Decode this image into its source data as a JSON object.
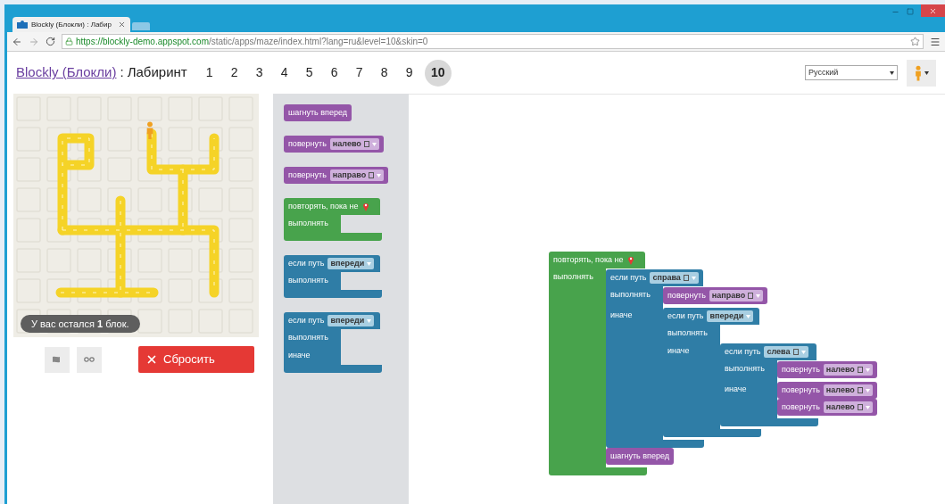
{
  "browser": {
    "tab_title": "Blockly (Блокли) : Лабир",
    "url_host": "https://blockly-demo.appspot.com",
    "url_path": "/static/apps/maze/index.html?lang=ru&level=10&skin=0"
  },
  "header": {
    "app_link": "Blockly (Блокли)",
    "separator": ":",
    "title": "Лабиринт",
    "levels": [
      {
        "label": "1",
        "selected": false
      },
      {
        "label": "2",
        "selected": false
      },
      {
        "label": "3",
        "selected": false
      },
      {
        "label": "4",
        "selected": false
      },
      {
        "label": "5",
        "selected": false
      },
      {
        "label": "6",
        "selected": false
      },
      {
        "label": "7",
        "selected": false
      },
      {
        "label": "8",
        "selected": false
      },
      {
        "label": "9",
        "selected": false
      },
      {
        "label": "10",
        "selected": true
      }
    ],
    "language": "Русский"
  },
  "maze": {
    "message": "У вас остался **1** блок.",
    "reset_button": "Сбросить"
  },
  "toolbox": [
    {
      "kind": "move",
      "label": "шагнуть вперед"
    },
    {
      "kind": "turn",
      "label": "повернуть",
      "option": {
        "text": "налево",
        "icon": true
      }
    },
    {
      "kind": "turn",
      "label": "повернуть",
      "option": {
        "text": "направо",
        "icon": true
      }
    },
    {
      "kind": "repeat",
      "label": "повторять, пока не",
      "do_label": "выполнять"
    },
    {
      "kind": "if",
      "label": "если путь",
      "option": {
        "text": "впереди",
        "icon": false
      },
      "do_label": "выполнять"
    },
    {
      "kind": "ifelse",
      "label": "если путь",
      "option": {
        "text": "впереди",
        "icon": false
      },
      "do_label": "выполнять",
      "else_label": "иначе"
    }
  ],
  "workspace": [
    {
      "kind": "repeat",
      "label": "повторять, пока не",
      "do_label": "выполнять",
      "body": [
        {
          "kind": "ifelse",
          "label": "если путь",
          "option": {
            "text": "справа",
            "icon": true
          },
          "do_label": "выполнять",
          "body": [
            {
              "kind": "turn",
              "label": "повернуть",
              "option": {
                "text": "направо",
                "icon": true
              }
            }
          ],
          "else_label": "иначе",
          "else_body": [
            {
              "kind": "ifelse",
              "label": "если путь",
              "option": {
                "text": "впереди",
                "icon": false
              },
              "do_label": "выполнять",
              "else_label": "иначе",
              "else_body": [
                {
                  "kind": "ifelse",
                  "label": "если путь",
                  "option": {
                    "text": "слева",
                    "icon": true
                  },
                  "do_label": "выполнять",
                  "body": [
                    {
                      "kind": "turn",
                      "label": "повернуть",
                      "option": {
                        "text": "налево",
                        "icon": true
                      }
                    }
                  ],
                  "else_label": "иначе",
                  "else_body": [
                    {
                      "kind": "turn",
                      "label": "повернуть",
                      "option": {
                        "text": "налево",
                        "icon": true
                      }
                    },
                    {
                      "kind": "turn",
                      "label": "повернуть",
                      "option": {
                        "text": "налево",
                        "icon": true
                      }
                    }
                  ]
                }
              ]
            }
          ]
        },
        {
          "kind": "move",
          "label": "шагнуть вперед"
        }
      ]
    }
  ]
}
